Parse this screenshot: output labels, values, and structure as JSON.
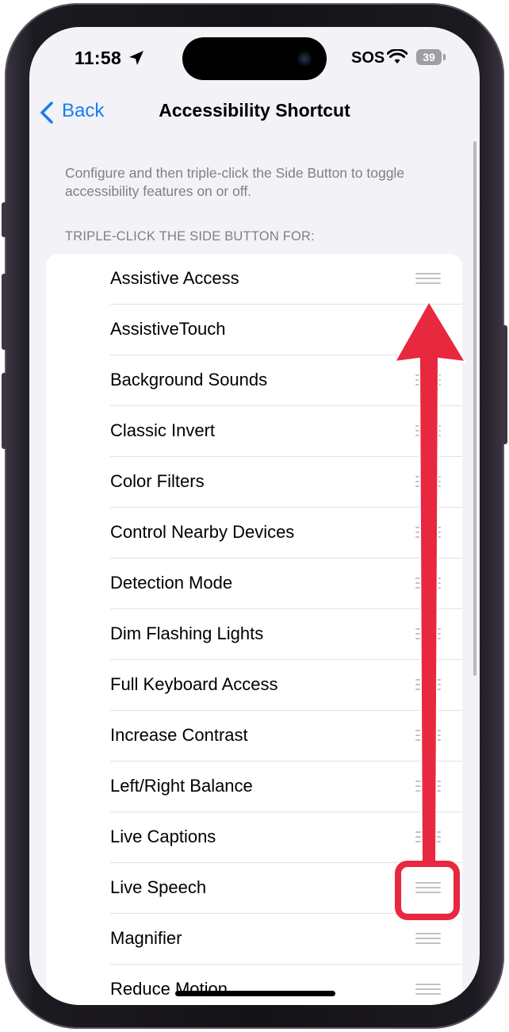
{
  "status_bar": {
    "time": "11:58",
    "carrier": "SOS",
    "battery": "39"
  },
  "nav": {
    "back_label": "Back",
    "title": "Accessibility Shortcut"
  },
  "description": "Configure and then triple-click the Side Button to toggle accessibility features on or off.",
  "section_header": "TRIPLE-CLICK THE SIDE BUTTON FOR:",
  "items": [
    "Assistive Access",
    "AssistiveTouch",
    "Background Sounds",
    "Classic Invert",
    "Color Filters",
    "Control Nearby Devices",
    "Detection Mode",
    "Dim Flashing Lights",
    "Full Keyboard Access",
    "Increase Contrast",
    "Left/Right Balance",
    "Live Captions",
    "Live Speech",
    "Magnifier",
    "Reduce Motion"
  ],
  "icons": {
    "back": "chevron-left-icon",
    "location": "location-arrow-icon",
    "wifi": "wifi-icon",
    "battery": "battery-icon",
    "reorder": "reorder-handle-icon",
    "annotation_arrow": "arrow-up-annotation",
    "annotation_box": "highlight-box-annotation"
  },
  "colors": {
    "accent": "#1a7cf5",
    "annotation": "#e8283f",
    "background": "#f2f2f7"
  }
}
